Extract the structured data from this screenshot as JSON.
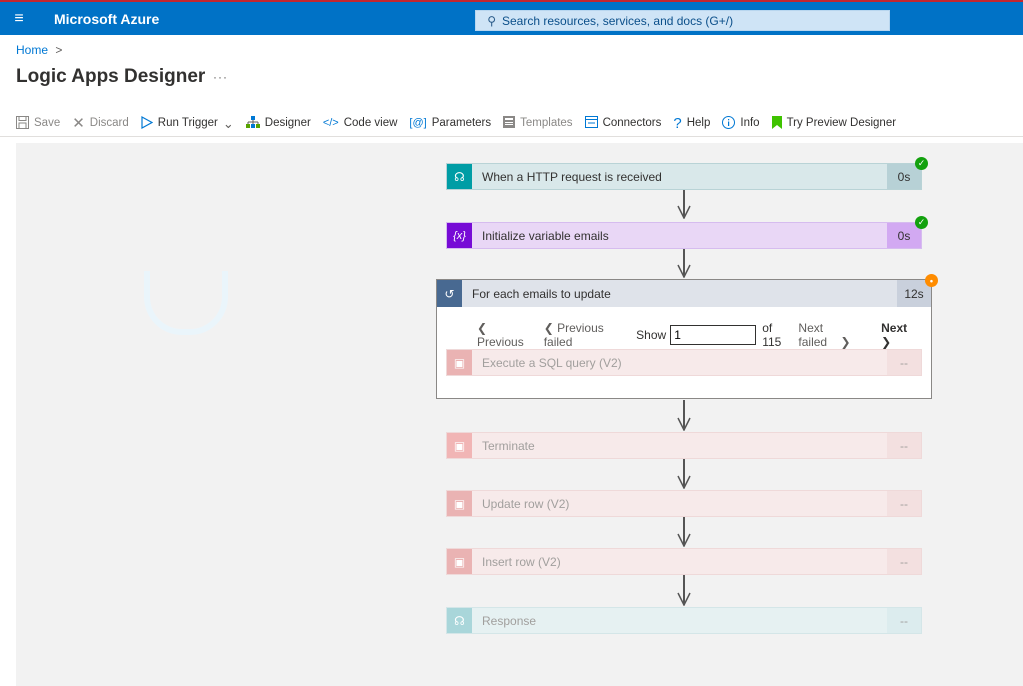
{
  "topbar": {
    "brand": "Microsoft Azure",
    "search_placeholder": "Search resources, services, and docs (G+/)"
  },
  "breadcrumb": {
    "home": "Home",
    "sep": ">"
  },
  "page": {
    "title": "Logic Apps Designer",
    "more": "···"
  },
  "toolbar": {
    "save": "Save",
    "discard": "Discard",
    "run_trigger": "Run Trigger",
    "designer": "Designer",
    "code_view": "Code view",
    "parameters": "Parameters",
    "templates": "Templates",
    "connectors": "Connectors",
    "help": "Help",
    "info": "Info",
    "try_preview": "Try Preview Designer"
  },
  "steps": {
    "http": {
      "label": "When a HTTP request is received",
      "duration": "0s",
      "status": "succeeded"
    },
    "init": {
      "label": "Initialize variable emails",
      "duration": "0s",
      "status": "succeeded"
    },
    "foreach": {
      "label": "For each emails to update",
      "duration": "12s",
      "status": "running",
      "pager": {
        "previous": "Previous",
        "previous_failed": "Previous failed",
        "show": "Show",
        "current": "1",
        "of": "of 115",
        "next_failed": "Next failed",
        "next": "Next"
      },
      "inner": {
        "label": "Execute a SQL query (V2)",
        "duration": "--"
      }
    },
    "terminate": {
      "label": "Terminate",
      "duration": "--"
    },
    "update": {
      "label": "Update row (V2)",
      "duration": "--"
    },
    "insert": {
      "label": "Insert row (V2)",
      "duration": "--"
    },
    "response": {
      "label": "Response",
      "duration": "--"
    }
  },
  "colors": {
    "azure_blue": "#0072c6",
    "http_icon": "#009da5",
    "var_icon": "#770bd6",
    "foreach_icon": "#486991",
    "sql_icon": "#ba141a",
    "success": "#13a10e",
    "running": "#ff8c00"
  }
}
